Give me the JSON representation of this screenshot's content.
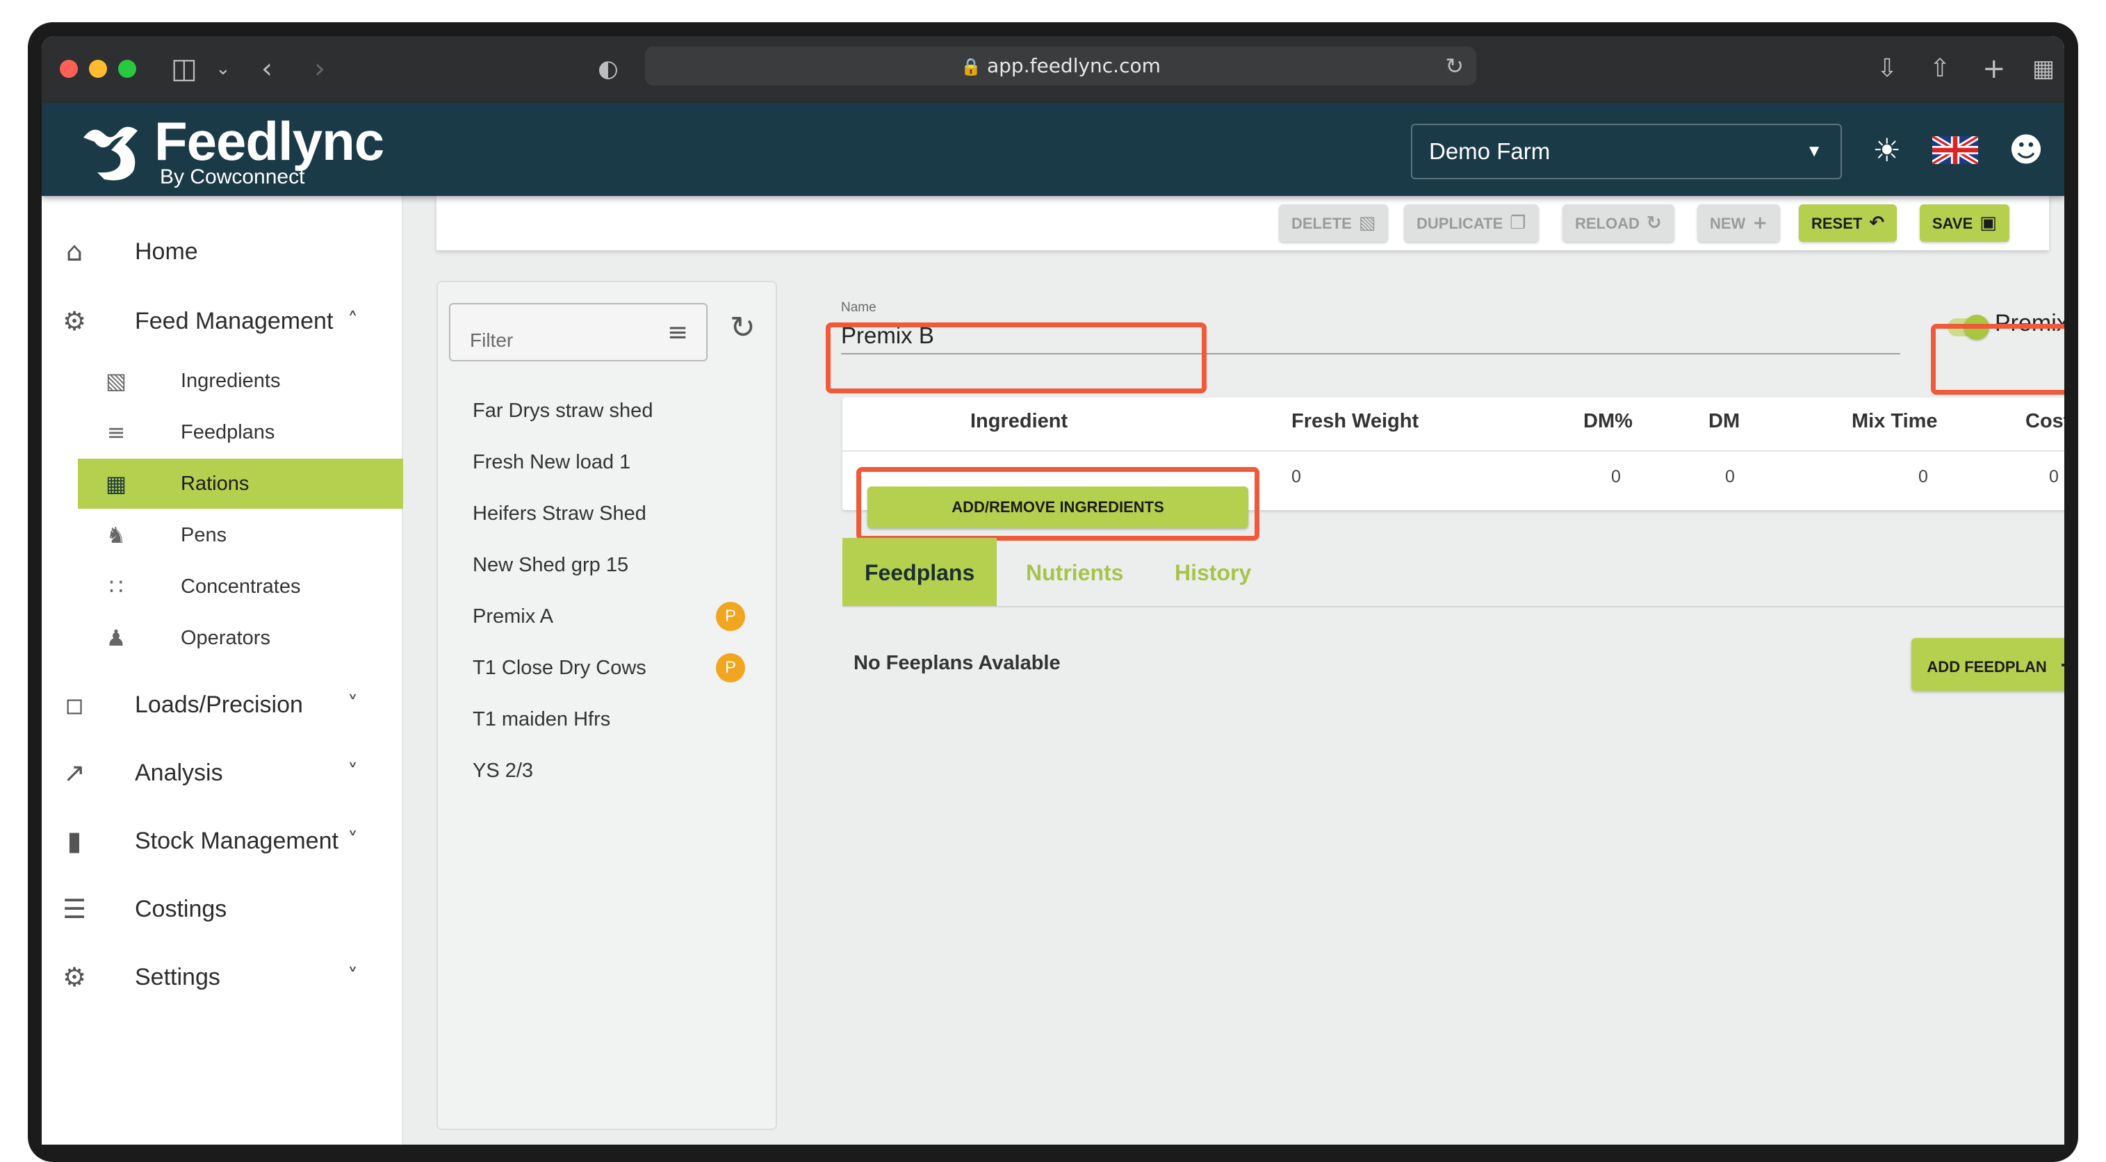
{
  "browser": {
    "url": "app.feedlync.com"
  },
  "brand": {
    "name": "Feedlync",
    "subtitle": "By Cowconnect"
  },
  "header": {
    "farm": "Demo Farm"
  },
  "sidebar": {
    "home": "Home",
    "feed_management": "Feed Management",
    "sub": [
      {
        "label": "Ingredients",
        "icon": "ingredient-icon"
      },
      {
        "label": "Feedplans",
        "icon": "feedplan-icon"
      },
      {
        "label": "Rations",
        "icon": "ration-icon",
        "active": true
      },
      {
        "label": "Pens",
        "icon": "pen-icon"
      },
      {
        "label": "Concentrates",
        "icon": "concentrate-icon"
      },
      {
        "label": "Operators",
        "icon": "operators-icon"
      }
    ],
    "loads": "Loads/Precision",
    "analysis": "Analysis",
    "stock": "Stock Management",
    "costings": "Costings",
    "settings": "Settings"
  },
  "toolbar": {
    "delete": "DELETE",
    "duplicate": "DUPLICATE",
    "reload": "RELOAD",
    "new": "NEW",
    "reset": "RESET",
    "save": "SAVE"
  },
  "list": {
    "filter_placeholder": "Filter",
    "items": [
      {
        "name": "Far Drys straw shed",
        "badge": ""
      },
      {
        "name": "Fresh New load 1",
        "badge": ""
      },
      {
        "name": "Heifers Straw Shed",
        "badge": ""
      },
      {
        "name": "New Shed grp 15",
        "badge": ""
      },
      {
        "name": "Premix A",
        "badge": "P"
      },
      {
        "name": "T1 Close Dry Cows",
        "badge": "P"
      },
      {
        "name": "T1 maiden Hfrs",
        "badge": ""
      },
      {
        "name": "YS 2/3",
        "badge": ""
      }
    ]
  },
  "detail": {
    "name_label": "Name",
    "name_value": "Premix B",
    "premix_label": "Premix",
    "premix_on": true,
    "table": {
      "headers": [
        "Ingredient",
        "Fresh Weight",
        "DM%",
        "DM",
        "Mix Time",
        "Cost"
      ],
      "add_button": "ADD/REMOVE INGREDIENTS",
      "values": [
        "0",
        "0",
        "0",
        "0",
        "0"
      ]
    },
    "tabs": [
      "Feedplans",
      "Nutrients",
      "History"
    ],
    "active_tab": "Feedplans",
    "no_feedplans": "No Feeplans Avalable",
    "add_feedplan": "ADD FEEDPLAN"
  },
  "colors": {
    "header_bg": "#1b3a47",
    "accent": "#b5cf4f",
    "badge": "#f2a51f",
    "highlight": "#ee5a3a"
  }
}
